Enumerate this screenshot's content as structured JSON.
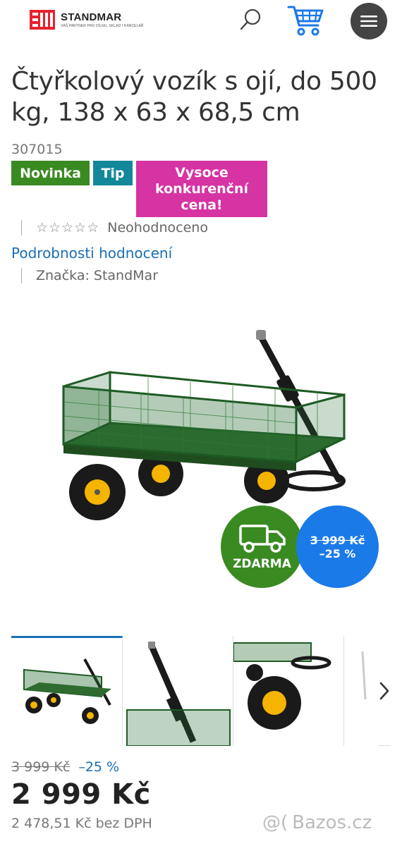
{
  "header": {
    "logo_name": "STANDMAR",
    "logo_tagline": "VÁŠ PARTNER PRO DÍLNU, SKLAD I KANCELÁŘ",
    "icons": [
      "search-icon",
      "cart-icon",
      "menu-icon"
    ]
  },
  "product": {
    "title": "Čtyřkolový vozík s ojí, do 500 kg, 138 x 63 x 68,5 cm",
    "sku": "307015",
    "badges": {
      "new": "Novinka",
      "tip": "Tip",
      "price": "Vysoce konkurenční cena!"
    },
    "rating_text": "Neohodnoceno",
    "rating_stars": 0,
    "rating_link": "Podrobnosti hodnocení",
    "brand": "Značka: StandMar"
  },
  "promo": {
    "delivery": "ZDARMA",
    "old_price": "3 999 Kč",
    "discount": "–25 %"
  },
  "pricing": {
    "old_price": "3 999 Kč",
    "discount": "–25 %",
    "price": "2 999 Kč",
    "price_without_vat": "2 478,51 Kč bez DPH"
  },
  "watermark": "Bazos.cz",
  "colors": {
    "green": "#3a8a22",
    "teal": "#12889a",
    "magenta": "#d633a3",
    "blue": "#1a7ae8",
    "link": "#1a6fb4",
    "logo_red": "#e3232d"
  }
}
